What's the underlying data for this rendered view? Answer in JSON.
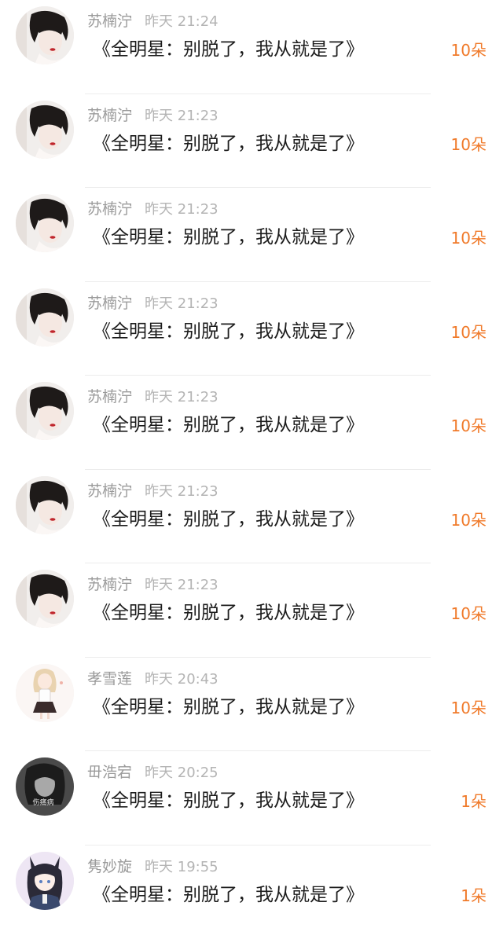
{
  "comments": [
    {
      "username": "苏楠泞",
      "time": "昨天 21:24",
      "content": "《全明星：别脱了，我从就是了》",
      "gift": "10朵",
      "avatar": "girl-portrait-icon"
    },
    {
      "username": "苏楠泞",
      "time": "昨天 21:23",
      "content": "《全明星：别脱了，我从就是了》",
      "gift": "10朵",
      "avatar": "girl-portrait-icon"
    },
    {
      "username": "苏楠泞",
      "time": "昨天 21:23",
      "content": "《全明星：别脱了，我从就是了》",
      "gift": "10朵",
      "avatar": "girl-portrait-icon"
    },
    {
      "username": "苏楠泞",
      "time": "昨天 21:23",
      "content": "《全明星：别脱了，我从就是了》",
      "gift": "10朵",
      "avatar": "girl-portrait-icon"
    },
    {
      "username": "苏楠泞",
      "time": "昨天 21:23",
      "content": "《全明星：别脱了，我从就是了》",
      "gift": "10朵",
      "avatar": "girl-portrait-icon"
    },
    {
      "username": "苏楠泞",
      "time": "昨天 21:23",
      "content": "《全明星：别脱了，我从就是了》",
      "gift": "10朵",
      "avatar": "girl-portrait-icon"
    },
    {
      "username": "苏楠泞",
      "time": "昨天 21:23",
      "content": "《全明星：别脱了，我从就是了》",
      "gift": "10朵",
      "avatar": "girl-portrait-icon"
    },
    {
      "username": "孝雪莲",
      "time": "昨天 20:43",
      "content": "《全明星：别脱了，我从就是了》",
      "gift": "10朵",
      "avatar": "cartoon-girl-icon"
    },
    {
      "username": "毌浩宕",
      "time": "昨天 20:25",
      "content": "《全明星：别脱了，我从就是了》",
      "gift": "1朵",
      "avatar": "grayscale-portrait-icon",
      "avatar_caption": "伤痛病"
    },
    {
      "username": "隽妙旋",
      "time": "昨天 19:55",
      "content": "《全明星：别脱了，我从就是了》",
      "gift": "1朵",
      "avatar": "anime-foxgirl-icon"
    }
  ],
  "colors": {
    "username": "#9a9a9a",
    "time": "#b4b4b4",
    "content": "#1c1c1c",
    "gift": "#f07a2a"
  }
}
